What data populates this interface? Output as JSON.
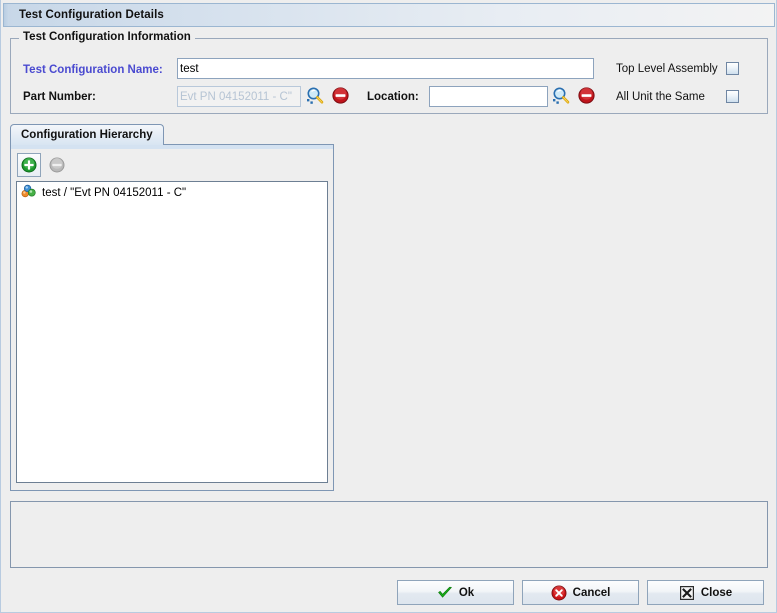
{
  "window": {
    "title": "Test Configuration Details"
  },
  "group": {
    "legend": "Test Configuration Information",
    "name_label": "Test Configuration Name:",
    "name_value": "test",
    "name_accent_color": "#4a4ad0",
    "part_label": "Part Number:",
    "part_value": "Evt PN 04152011 - C\"",
    "part_search_icon": "magnifier-icon",
    "part_clear_icon": "remove-circle-icon",
    "location_label": "Location:",
    "location_value": "",
    "location_search_icon": "magnifier-icon",
    "location_clear_icon": "remove-circle-icon",
    "checkboxes": [
      {
        "label": "Top Level Assembly",
        "checked": false
      },
      {
        "label": "All Unit the Same",
        "checked": false
      }
    ]
  },
  "tabs": [
    {
      "label": "Configuration Hierarchy",
      "selected": true
    }
  ],
  "tree_toolbar": {
    "add_icon": "add-circle-icon",
    "add_enabled": true,
    "remove_icon": "remove-circle-icon",
    "remove_enabled": false
  },
  "tree": {
    "nodes": [
      {
        "icon": "assembly-nodes-icon",
        "label": "test / \"Evt PN 04152011 - C\""
      }
    ]
  },
  "bottom_panel": {
    "content": ""
  },
  "buttons": [
    {
      "label": "Ok",
      "icon": "green-check-icon"
    },
    {
      "label": "Cancel",
      "icon": "red-error-circle-icon"
    },
    {
      "label": "Close",
      "icon": "close-box-icon"
    }
  ]
}
